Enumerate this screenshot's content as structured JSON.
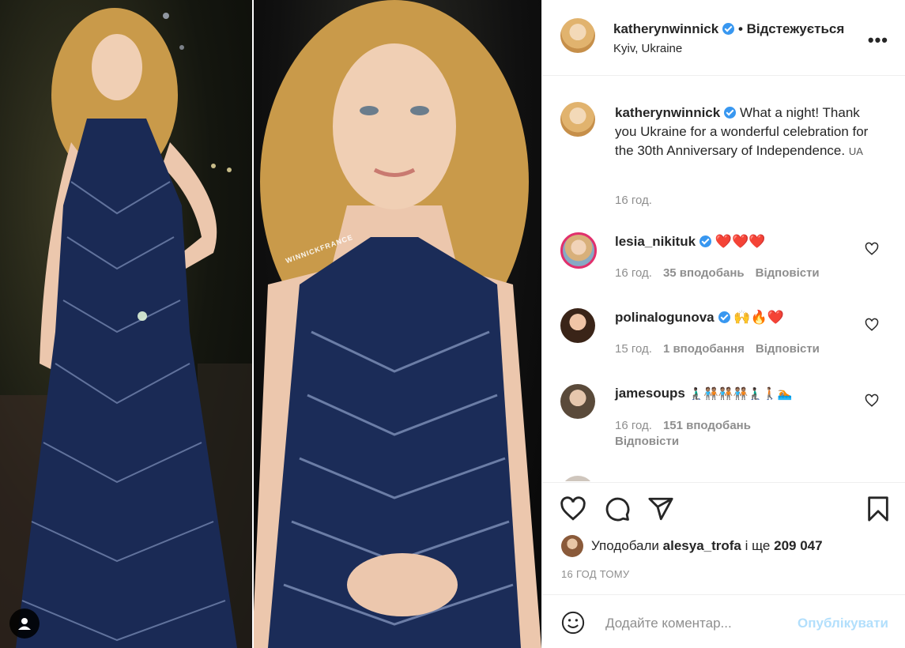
{
  "post": {
    "username": "katherynwinnick",
    "separator": "•",
    "follow_status": "Відстежується",
    "location": "Kyiv, Ukraine",
    "more_icon": "more-dots-icon",
    "watermark": "WINNICKFRANCE"
  },
  "caption": {
    "username": "katherynwinnick",
    "text": "What a night! Thank you Ukraine for a wonderful celebration for the 30th Anniversary of Independence.",
    "flag_text": "UA",
    "time": "16 год."
  },
  "comments": [
    {
      "username": "lesia_nikituk",
      "verified": true,
      "text": "❤️❤️❤️",
      "time": "16 год.",
      "likes": "35 вподобань",
      "reply": "Відповісти"
    },
    {
      "username": "polinalogunova",
      "verified": true,
      "text": "🙌🔥❤️",
      "time": "15 год.",
      "likes": "1 вподобання",
      "reply": "Відповісти"
    },
    {
      "username": "jamesoups",
      "verified": false,
      "text": "🧎🏿‍♂️🧑🏽‍🤝‍🧑🏽🧑🏽‍🤝‍🧑🏽🧑🏽‍🤝‍🧑🏽🧎🏿‍♂️🚶🏽🏊🏽",
      "time": "16 год.",
      "likes": "151 вподобань",
      "reply": "Відповісти"
    }
  ],
  "likes": {
    "prefix": "Уподобали",
    "user": "alesya_trofa",
    "and": "і ще",
    "count": "209 047"
  },
  "time_ago": "16 ГОД ТОМУ",
  "comment_box": {
    "placeholder": "Додайте коментар...",
    "publish_label": "Опублікувати"
  },
  "colors": {
    "verified": "#3897f0",
    "heart_red": "#ed4956",
    "publish_disabled": "#b2dffc",
    "meta_gray": "#8e8e8e"
  }
}
